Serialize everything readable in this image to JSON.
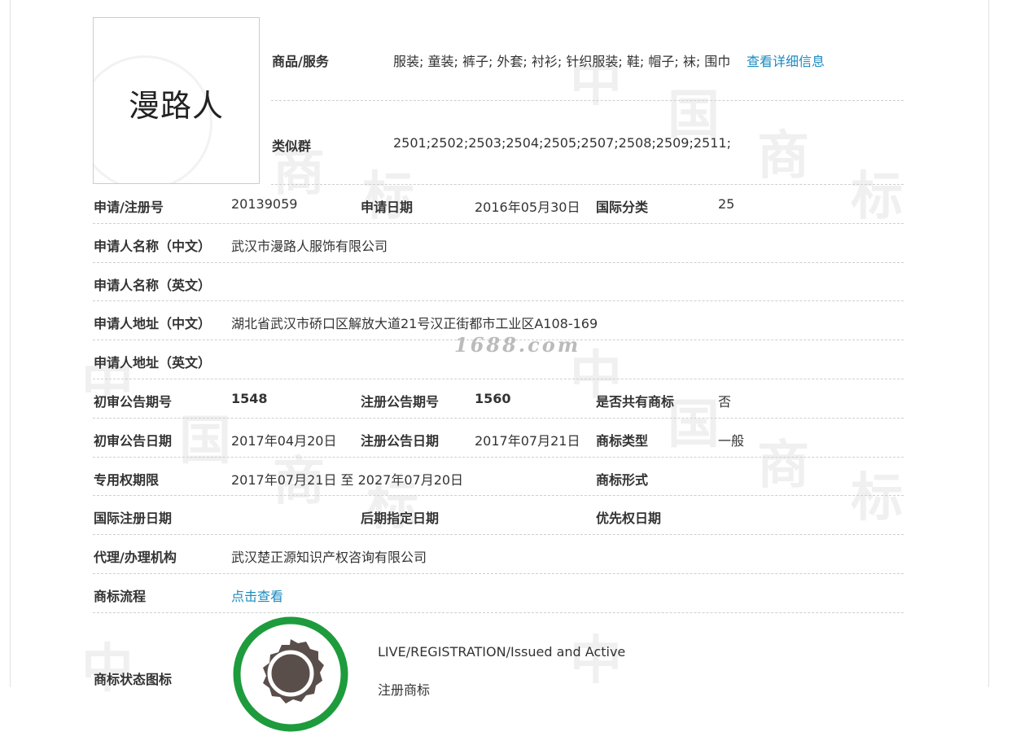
{
  "trademark": {
    "logo_text": "漫路人"
  },
  "goods": {
    "label": "商品/服务",
    "value": "服装; 童装; 裤子; 外套; 衬衫; 针织服装; 鞋; 帽子; 袜; 围巾",
    "detail_link": "查看详细信息"
  },
  "similar_group": {
    "label": "类似群",
    "value": "2501;2502;2503;2504;2505;2507;2508;2509;2511;"
  },
  "fields": {
    "reg_no": {
      "label": "申请/注册号",
      "value": "20139059"
    },
    "apply_date": {
      "label": "申请日期",
      "value": "2016年05月30日"
    },
    "intl_class": {
      "label": "国际分类",
      "value": "25"
    },
    "applicant_cn": {
      "label": "申请人名称（中文）",
      "value": "武汉市漫路人服饰有限公司"
    },
    "applicant_en": {
      "label": "申请人名称（英文）",
      "value": ""
    },
    "address_cn": {
      "label": "申请人地址（中文）",
      "value": "湖北省武汉市硚口区解放大道21号汉正街都市工业区A108-169"
    },
    "address_en": {
      "label": "申请人地址（英文）",
      "value": ""
    },
    "prelim_pub_no": {
      "label": "初审公告期号",
      "value": "1548"
    },
    "reg_pub_no": {
      "label": "注册公告期号",
      "value": "1560"
    },
    "shared": {
      "label": "是否共有商标",
      "value": "否"
    },
    "prelim_pub_date": {
      "label": "初审公告日期",
      "value": "2017年04月20日"
    },
    "reg_pub_date": {
      "label": "注册公告日期",
      "value": "2017年07月21日"
    },
    "tm_type": {
      "label": "商标类型",
      "value": "一般"
    },
    "exclusive_period": {
      "label": "专用权期限",
      "value": "2017年07月21日 至 2027年07月20日"
    },
    "tm_form": {
      "label": "商标形式",
      "value": ""
    },
    "intl_reg_date": {
      "label": "国际注册日期",
      "value": ""
    },
    "later_designation": {
      "label": "后期指定日期",
      "value": ""
    },
    "priority_date": {
      "label": "优先权日期",
      "value": ""
    },
    "agency": {
      "label": "代理/办理机构",
      "value": "武汉楚正源知识产权咨询有限公司"
    },
    "process": {
      "label": "商标流程",
      "link": "点击查看"
    },
    "status_icon": {
      "label": "商标状态图标",
      "status_en": "LIVE/REGISTRATION/Issued and Active",
      "status_cn": "注册商标"
    }
  },
  "overlay_watermark": "1688.com",
  "watermark_chars": [
    "中",
    "国",
    "商",
    "标"
  ],
  "colors": {
    "link": "#1c8bc0",
    "status_ring": "#1e9b3c",
    "seal": "#5a4e4b"
  }
}
